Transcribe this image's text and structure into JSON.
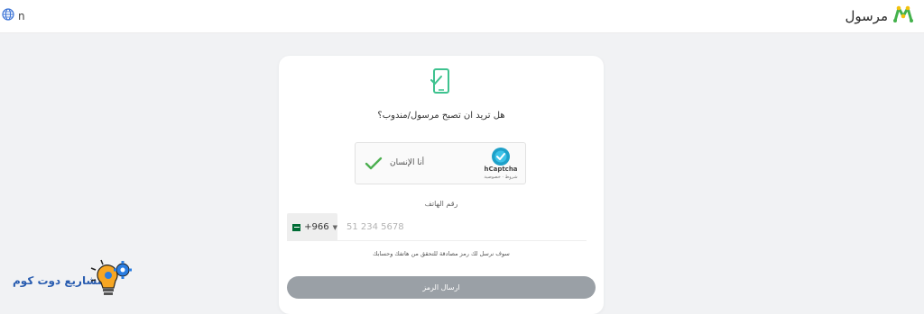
{
  "header": {
    "language_code": "n",
    "brand_name": "مرسول",
    "colors": {
      "brand_green": "#43b14b",
      "brand_yellow": "#f4c20d"
    }
  },
  "card": {
    "icon": "phone-check-icon",
    "question": "هل تريد ان تصبح مرسول/مندوب؟",
    "captcha": {
      "label": "أنا الإنسان",
      "brand": "hCaptcha",
      "terms": "شروط · خصوصية"
    },
    "phone": {
      "label": "رقم الهاتف",
      "country_code": "+966",
      "placeholder": "51 234 5678",
      "value": ""
    },
    "notice": "سوف نرسل لك رمز مصادقة للتحقق من هاتفك وحسابك",
    "submit_label": "ارسال الرمز"
  },
  "watermark": {
    "text": "مشاريع دوت كوم"
  },
  "colors": {
    "page_bg": "#f1f2f4",
    "accent_green": "#3ec28f",
    "button_disabled": "#9aa0a6"
  }
}
